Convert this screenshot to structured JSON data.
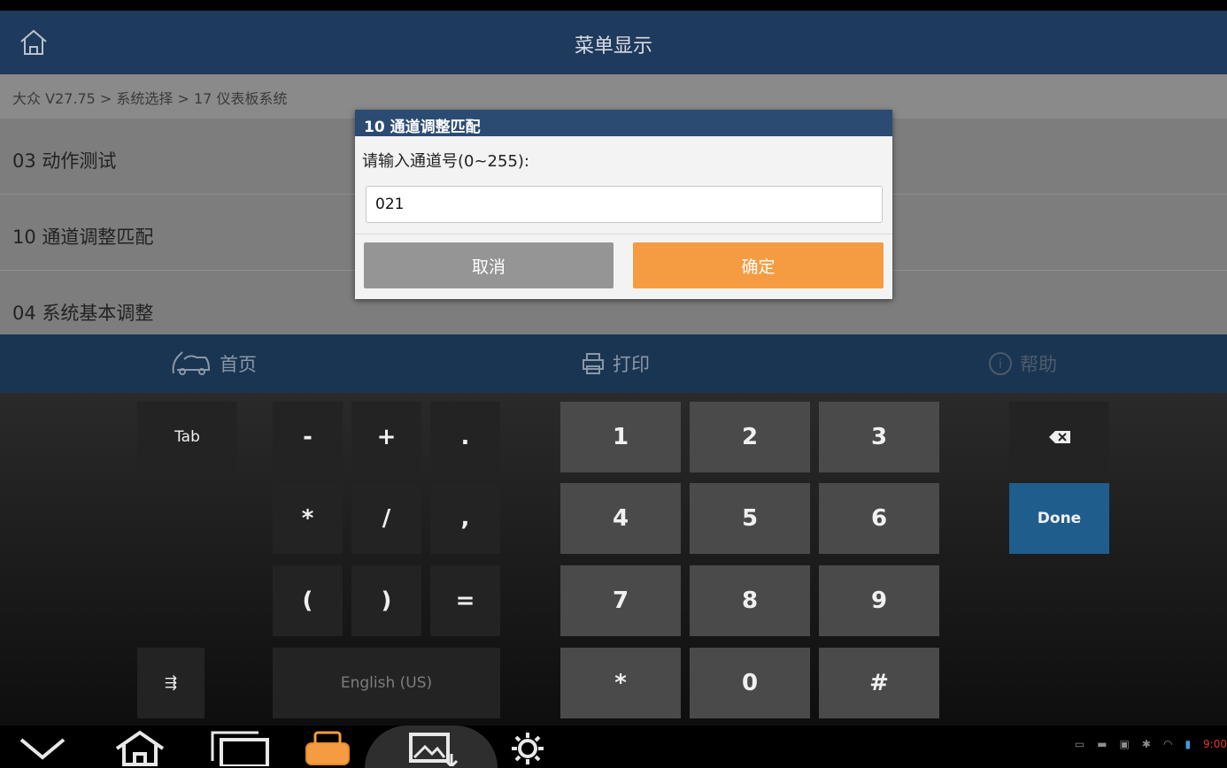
{
  "header": {
    "title": "菜单显示"
  },
  "breadcrumb": "大众 V27.75 > 系统选择 > 17 仪表板系统",
  "menu": {
    "items": [
      {
        "label": "03 动作测试"
      },
      {
        "label": "10 通道调整匹配"
      },
      {
        "label": "04 系统基本调整"
      }
    ]
  },
  "bottombar": {
    "home": "首页",
    "print": "打印",
    "help": "帮助"
  },
  "dialog": {
    "title": "10 通道调整匹配",
    "prompt": "请输入通道号(0~255):",
    "input_value": "021",
    "cancel": "取消",
    "confirm": "确定"
  },
  "keyboard": {
    "tab": "Tab",
    "sym_row1": [
      "-",
      "+",
      "."
    ],
    "sym_row2": [
      "*",
      "/",
      ","
    ],
    "sym_row3": [
      "(",
      ")",
      "="
    ],
    "num_row1": [
      "1",
      "2",
      "3"
    ],
    "num_row2": [
      "4",
      "5",
      "6"
    ],
    "num_row3": [
      "7",
      "8",
      "9"
    ],
    "num_row4": [
      "*",
      "0",
      "#"
    ],
    "done": "Done",
    "language": "English (US)",
    "settings_glyph": "⇶"
  },
  "status": {
    "time": "9:00"
  },
  "colors": {
    "accent_orange": "#f59c42",
    "title_blue": "#1e3a5c",
    "done_blue": "#1f5e8c"
  }
}
